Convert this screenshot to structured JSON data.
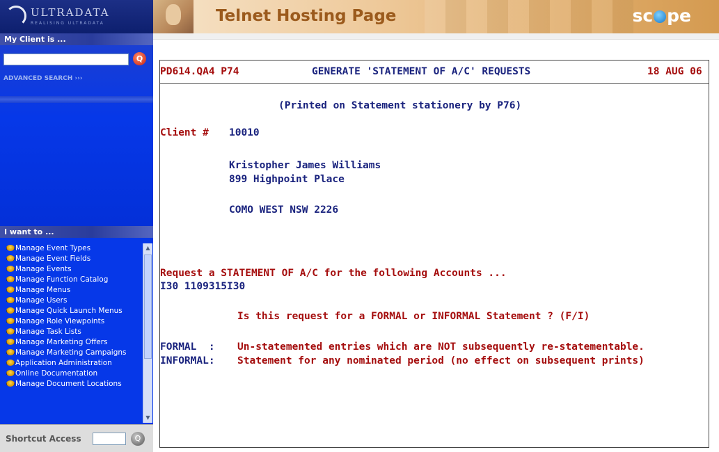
{
  "sidebar": {
    "logo_text": "ULTRADATA",
    "logo_tagline": "REALISING ULTRADATA",
    "client_header": "My Client is ...",
    "advanced_search": "ADVANCED SEARCH",
    "iwant_header": "I want to ...",
    "menu_items": [
      "Manage Event Types",
      "Manage Event Fields",
      "Manage Events",
      "Manage Function Catalog",
      "Manage Menus",
      "Manage Users",
      "Manage Quick Launch Menus",
      "Manage Role Viewpoints",
      "Manage Task Lists",
      "Manage Marketing Offers",
      "Manage Marketing Campaigns",
      "Application Administration",
      "Online Documentation",
      "Manage Document Locations"
    ],
    "shortcut_label": "Shortcut Access"
  },
  "banner": {
    "title": "Telnet Hosting Page",
    "logo_pre": "sc",
    "logo_post": "pe"
  },
  "terminal": {
    "screen_id": "PD614.QA4 P74",
    "heading": "GENERATE 'STATEMENT OF A/C' REQUESTS",
    "date": "18 AUG 06",
    "subheading": "(Printed on Statement stationery by P76)",
    "client_label": "Client #",
    "client_number": "10010",
    "address_line1": "Kristopher James Williams",
    "address_line2": "899 Highpoint Place",
    "address_line3": "COMO WEST NSW 2226",
    "request_text": "Request a STATEMENT OF A/C for the following Accounts ...",
    "account": "I30 1109315I30",
    "question": "Is this request for a FORMAL or INFORMAL Statement ? (F/I)",
    "formal_label": "FORMAL  :",
    "formal_desc": "Un-statemented entries which are NOT subsequently re-statementable.",
    "informal_label": "INFORMAL:",
    "informal_desc": "Statement for any nominated period (no effect on subsequent prints)"
  },
  "colors": {
    "sidebar_blue": "#0638e8",
    "terminal_red": "#a50e0e",
    "terminal_navy": "#1a237e",
    "banner_title": "#9b5a1c"
  }
}
